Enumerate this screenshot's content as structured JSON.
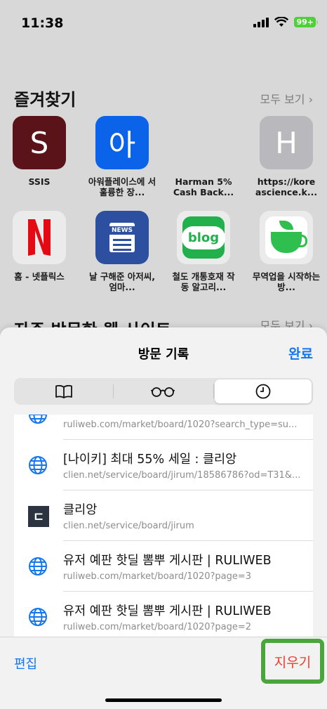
{
  "status_bar": {
    "time": "11:38",
    "battery": "99+"
  },
  "favorites": {
    "title": "즐겨찾기",
    "more_label": "모두 보기 ›",
    "items": [
      {
        "label": "SSIS",
        "glyph": "S",
        "bg": "#5a1419"
      },
      {
        "label": "아워플레이스에 서 훌륭한 장...",
        "glyph": "아",
        "bg": "#0a63e8"
      },
      {
        "label": "Harman 5% Cash Back...",
        "glyph": "",
        "bg": ""
      },
      {
        "label": "https://kore ascience.k...",
        "glyph": "H",
        "bg": "#b9b9bd"
      },
      {
        "label": "홈 - 넷플릭스",
        "glyph": "N",
        "bg": "#ebebeb"
      },
      {
        "label": "날 구해준 아저씨, 엄마...",
        "glyph": "NEWS",
        "bg": "#2c4fa0"
      },
      {
        "label": "철도 개통호재 작동 알고리...",
        "glyph": "blog",
        "bg": "#21b04b"
      },
      {
        "label": "무역업을 시작하는 방...",
        "glyph": "cup",
        "bg": "#ebebeb"
      }
    ]
  },
  "frequent": {
    "title": "자주 방문한 웹 사이트",
    "more_label": "모두 보기 ›"
  },
  "sheet": {
    "title": "방문 기록",
    "done_label": "완료",
    "tabs": [
      "bookmarks",
      "reading-list",
      "history"
    ],
    "active_tab": "history"
  },
  "history": [
    {
      "title": "",
      "url": "ruliweb.com/market/board/1020?search_type=su...",
      "icon": "globe"
    },
    {
      "title": "[나이키] 최대 55% 세일 : 클리앙",
      "url": "clien.net/service/board/jirum/18586786?od=T31&...",
      "icon": "globe"
    },
    {
      "title": "클리앙",
      "url": "clien.net/service/board/jirum",
      "icon": "clien"
    },
    {
      "title": "유저 예판 핫딜 뽐뿌 게시판 | RULIWEB",
      "url": "ruliweb.com/market/board/1020?page=3",
      "icon": "globe"
    },
    {
      "title": "유저 예판 핫딜 뽐뿌 게시판 | RULIWEB",
      "url": "ruliweb.com/market/board/1020?page=2",
      "icon": "globe"
    }
  ],
  "toolbar": {
    "edit_label": "편집",
    "clear_label": "지우기"
  },
  "colors": {
    "accent": "#1477f0",
    "destructive": "#f23b30",
    "highlight": "#4aa63c"
  }
}
